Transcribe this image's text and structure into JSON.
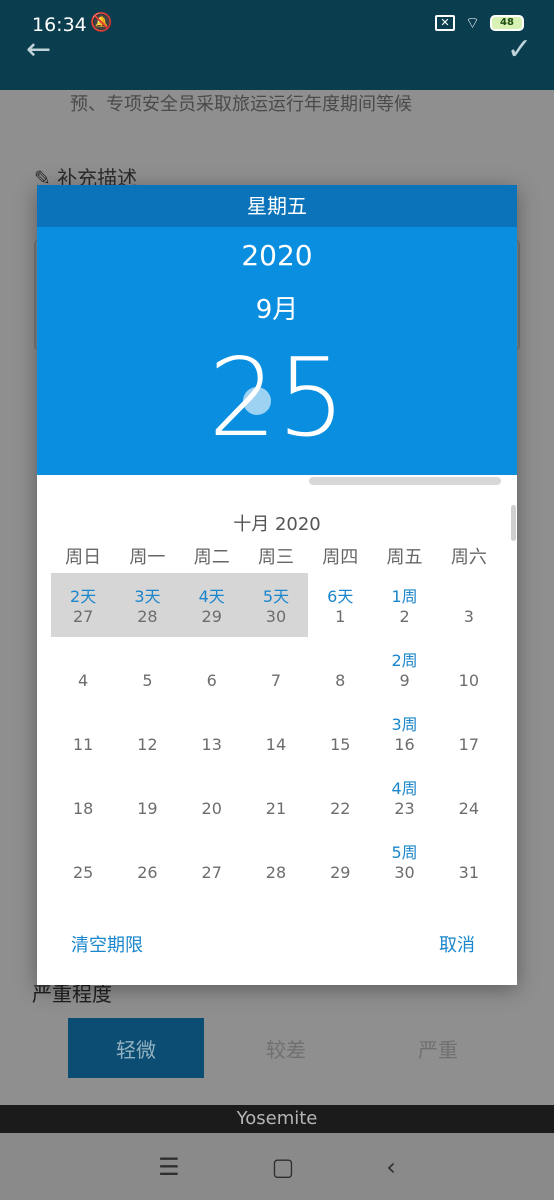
{
  "status": {
    "time": "16:34",
    "battery": "48"
  },
  "background": {
    "line_text": "预、专项安全员采取旅运运行年度期间等候",
    "section_title": "补充描述",
    "severity_title": "严重程度",
    "severity_options": [
      "轻微",
      "较差",
      "严重"
    ]
  },
  "dialog": {
    "weekday": "星期五",
    "year": "2020",
    "month": "9月",
    "day": "25",
    "calendar_title": "十月 2020",
    "weekdays": [
      "周日",
      "周一",
      "周二",
      "周三",
      "周四",
      "周五",
      "周六"
    ],
    "rows": [
      [
        {
          "badge": "2天",
          "num": "27",
          "sel": true
        },
        {
          "badge": "3天",
          "num": "28",
          "sel": true
        },
        {
          "badge": "4天",
          "num": "29",
          "sel": true
        },
        {
          "badge": "5天",
          "num": "30",
          "sel": true
        },
        {
          "badge": "6天",
          "num": "1"
        },
        {
          "badge": "1周",
          "num": "2"
        },
        {
          "badge": "",
          "num": "3"
        }
      ],
      [
        {
          "badge": "",
          "num": "4"
        },
        {
          "badge": "",
          "num": "5"
        },
        {
          "badge": "",
          "num": "6"
        },
        {
          "badge": "",
          "num": "7"
        },
        {
          "badge": "",
          "num": "8"
        },
        {
          "badge": "2周",
          "num": "9"
        },
        {
          "badge": "",
          "num": "10"
        }
      ],
      [
        {
          "badge": "",
          "num": "11"
        },
        {
          "badge": "",
          "num": "12"
        },
        {
          "badge": "",
          "num": "13"
        },
        {
          "badge": "",
          "num": "14"
        },
        {
          "badge": "",
          "num": "15"
        },
        {
          "badge": "3周",
          "num": "16"
        },
        {
          "badge": "",
          "num": "17"
        }
      ],
      [
        {
          "badge": "",
          "num": "18"
        },
        {
          "badge": "",
          "num": "19"
        },
        {
          "badge": "",
          "num": "20"
        },
        {
          "badge": "",
          "num": "21"
        },
        {
          "badge": "",
          "num": "22"
        },
        {
          "badge": "4周",
          "num": "23"
        },
        {
          "badge": "",
          "num": "24"
        }
      ],
      [
        {
          "badge": "",
          "num": "25"
        },
        {
          "badge": "",
          "num": "26"
        },
        {
          "badge": "",
          "num": "27"
        },
        {
          "badge": "",
          "num": "28"
        },
        {
          "badge": "",
          "num": "29"
        },
        {
          "badge": "5周",
          "num": "30"
        },
        {
          "badge": "",
          "num": "31"
        }
      ]
    ],
    "clear_label": "清空期限",
    "cancel_label": "取消"
  },
  "footer": {
    "label": "Yosemite"
  }
}
